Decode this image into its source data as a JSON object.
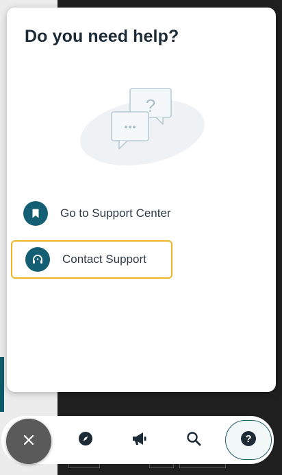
{
  "panel": {
    "title": "Do you need help?"
  },
  "options": [
    {
      "label": "Go to Support Center",
      "icon": "bookmark-icon"
    },
    {
      "label": "Contact Support",
      "icon": "headset-icon"
    }
  ],
  "navbar": {
    "items": [
      "close-icon",
      "compass-icon",
      "megaphone-icon",
      "search-icon",
      "help-icon"
    ],
    "active": "help-icon"
  },
  "colors": {
    "accent": "#145f73",
    "focus_outline": "#f0b429",
    "title": "#1d2b36"
  }
}
